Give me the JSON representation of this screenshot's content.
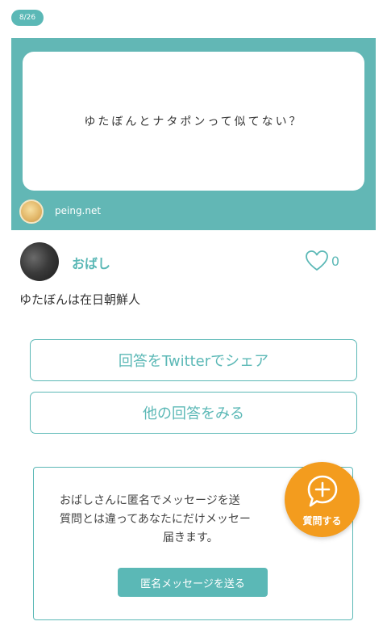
{
  "date": "8/26",
  "question": {
    "text": "ゆたぼんとナタポンって似てない？",
    "site": "peing.net"
  },
  "answer": {
    "user_name": "おばし",
    "like_count": "0",
    "text": "ゆたぼんは在日朝鮮人"
  },
  "actions": {
    "share_label": "回答をTwitterでシェア",
    "other_label": "他の回答をみる"
  },
  "message_box": {
    "line1": "おばしさんに匿名でメッセージを送",
    "line2": "質問とは違ってあなたにだけメッセー",
    "line3": "届きます。",
    "button_label": "匿名メッセージを送る"
  },
  "fab": {
    "label": "質問する"
  },
  "colors": {
    "teal": "#5bb8b6",
    "orange": "#f39c1e"
  }
}
